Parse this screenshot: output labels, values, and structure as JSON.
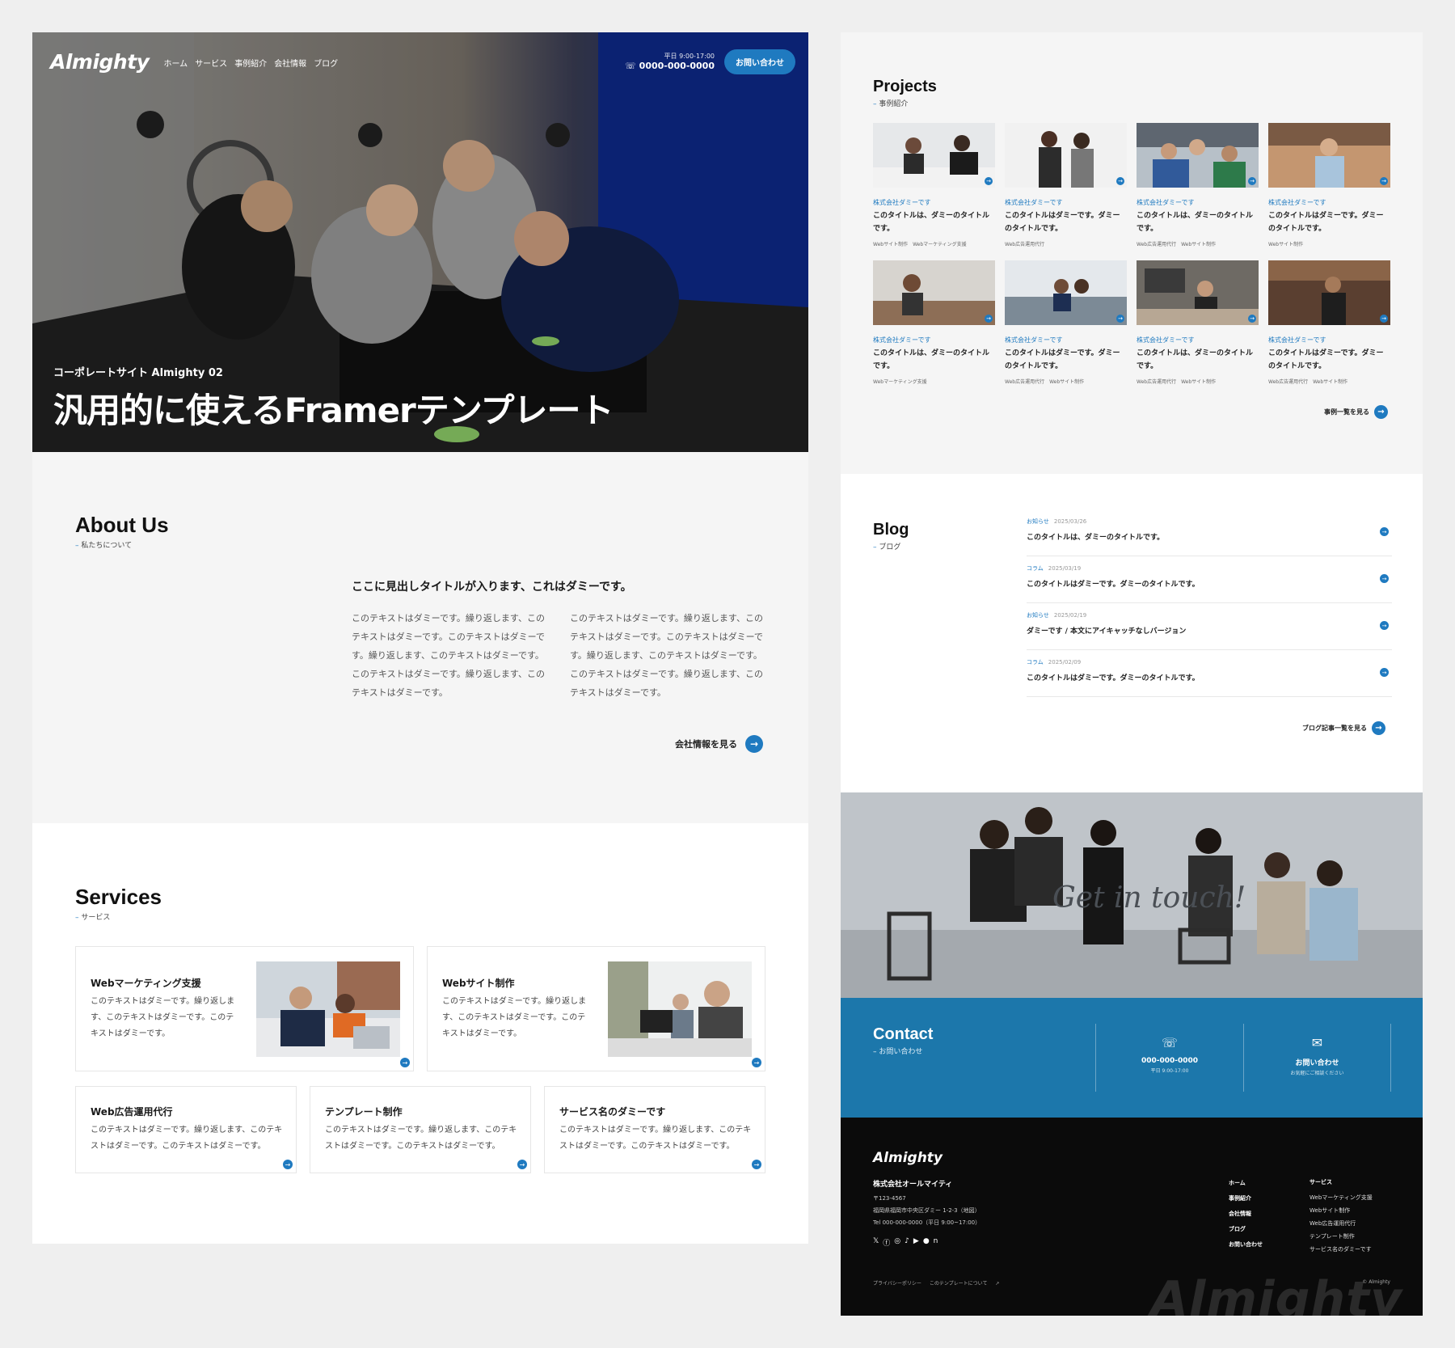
{
  "header": {
    "logo": "Almighty",
    "nav": [
      "ホーム",
      "サービス",
      "事例紹介",
      "会社情報",
      "ブログ"
    ],
    "tel_hours": "平日 9:00-17:00",
    "tel_number": "0000-000-0000",
    "contact_button": "お問い合わせ"
  },
  "hero": {
    "subtitle": "コーポレートサイト Almighty 02",
    "title": "汎用的に使えるFramerテンプレート"
  },
  "about": {
    "title": "About Us",
    "subtitle": "私たちについて",
    "heading": "ここに見出しタイトルが入ります、これはダミーです。",
    "col1": "このテキストはダミーです。繰り返します、このテキストはダミーです。このテキストはダミーです。繰り返します、このテキストはダミーです。このテキストはダミーです。繰り返します、このテキストはダミーです。",
    "col2": "このテキストはダミーです。繰り返します、このテキストはダミーです。このテキストはダミーです。繰り返します、このテキストはダミーです。このテキストはダミーです。繰り返します、このテキストはダミーです。",
    "link": "会社情報を見る"
  },
  "services": {
    "title": "Services",
    "subtitle": "サービス",
    "cards": [
      {
        "title": "Webマーケティング支援",
        "desc": "このテキストはダミーです。繰り返します、このテキストはダミーです。このテキストはダミーです。"
      },
      {
        "title": "Webサイト制作",
        "desc": "このテキストはダミーです。繰り返します、このテキストはダミーです。このテキストはダミーです。"
      },
      {
        "title": "Web広告運用代行",
        "desc": "このテキストはダミーです。繰り返します、このテキストはダミーです。このテキストはダミーです。"
      },
      {
        "title": "テンプレート制作",
        "desc": "このテキストはダミーです。繰り返します、このテキストはダミーです。このテキストはダミーです。"
      },
      {
        "title": "サービス名のダミーです",
        "desc": "このテキストはダミーです。繰り返します、このテキストはダミーです。このテキストはダミーです。"
      }
    ]
  },
  "projects": {
    "title": "Projects",
    "subtitle": "事例紹介",
    "items": [
      {
        "company": "株式会社ダミーです",
        "title": "このタイトルは、ダミーのタイトルです。",
        "tags": "Webサイト制作　Webマーケティング支援"
      },
      {
        "company": "株式会社ダミーです",
        "title": "このタイトルはダミーです。ダミーのタイトルです。",
        "tags": "Web広告運用代行"
      },
      {
        "company": "株式会社ダミーです",
        "title": "このタイトルは、ダミーのタイトルです。",
        "tags": "Web広告運用代行　Webサイト制作"
      },
      {
        "company": "株式会社ダミーです",
        "title": "このタイトルはダミーです。ダミーのタイトルです。",
        "tags": "Webサイト制作"
      },
      {
        "company": "株式会社ダミーです",
        "title": "このタイトルは、ダミーのタイトルです。",
        "tags": "Webマーケティング支援"
      },
      {
        "company": "株式会社ダミーです",
        "title": "このタイトルはダミーです。ダミーのタイトルです。",
        "tags": "Web広告運用代行　Webサイト制作"
      },
      {
        "company": "株式会社ダミーです",
        "title": "このタイトルは、ダミーのタイトルです。",
        "tags": "Web広告運用代行　Webサイト制作"
      },
      {
        "company": "株式会社ダミーです",
        "title": "このタイトルはダミーです。ダミーのタイトルです。",
        "tags": "Web広告運用代行　Webサイト制作"
      }
    ],
    "link": "事例一覧を見る"
  },
  "blog": {
    "title": "Blog",
    "subtitle": "ブログ",
    "posts": [
      {
        "category": "お知らせ",
        "date": "2025/03/26",
        "title": "このタイトルは、ダミーのタイトルです。"
      },
      {
        "category": "コラム",
        "date": "2025/03/19",
        "title": "このタイトルはダミーです。ダミーのタイトルです。"
      },
      {
        "category": "お知らせ",
        "date": "2025/02/19",
        "title": "ダミーです / 本文にアイキャッチなしバージョン"
      },
      {
        "category": "コラム",
        "date": "2025/02/09",
        "title": "このタイトルはダミーです。ダミーのタイトルです。"
      }
    ],
    "link": "ブログ記事一覧を見る"
  },
  "touch": {
    "text": "Get in touch!"
  },
  "contact": {
    "title": "Contact",
    "subtitle": "お問い合わせ",
    "phone": "000-000-0000",
    "phone_hours": "平日 9:00-17:00",
    "form": "お問い合わせ",
    "form_note": "お気軽にご相談ください"
  },
  "footer": {
    "logo": "Almighty",
    "company": "株式会社オールマイティ",
    "zip": "〒123-4567",
    "address": "福岡県福岡市中央区ダミー 1-2-3（地図）",
    "tel": "Tel 000-000-0000（平日 9:00~17:00）",
    "nav": [
      "ホーム",
      "事例紹介",
      "会社情報",
      "ブログ",
      "お問い合わせ"
    ],
    "service_nav": [
      "サービス",
      "Webマーケティング支援",
      "Webサイト制作",
      "Web広告運用代行",
      "テンプレート制作",
      "サービス名のダミーです"
    ],
    "privacy": "プライバシーポリシー",
    "about_template": "このテンプレートについて",
    "copyright": "© Almighty",
    "watermark": "Almighty"
  },
  "colors": {
    "accent": "#1f7ac0",
    "contact_bg": "#1c77ab",
    "footer_bg": "#0b0b0b"
  }
}
